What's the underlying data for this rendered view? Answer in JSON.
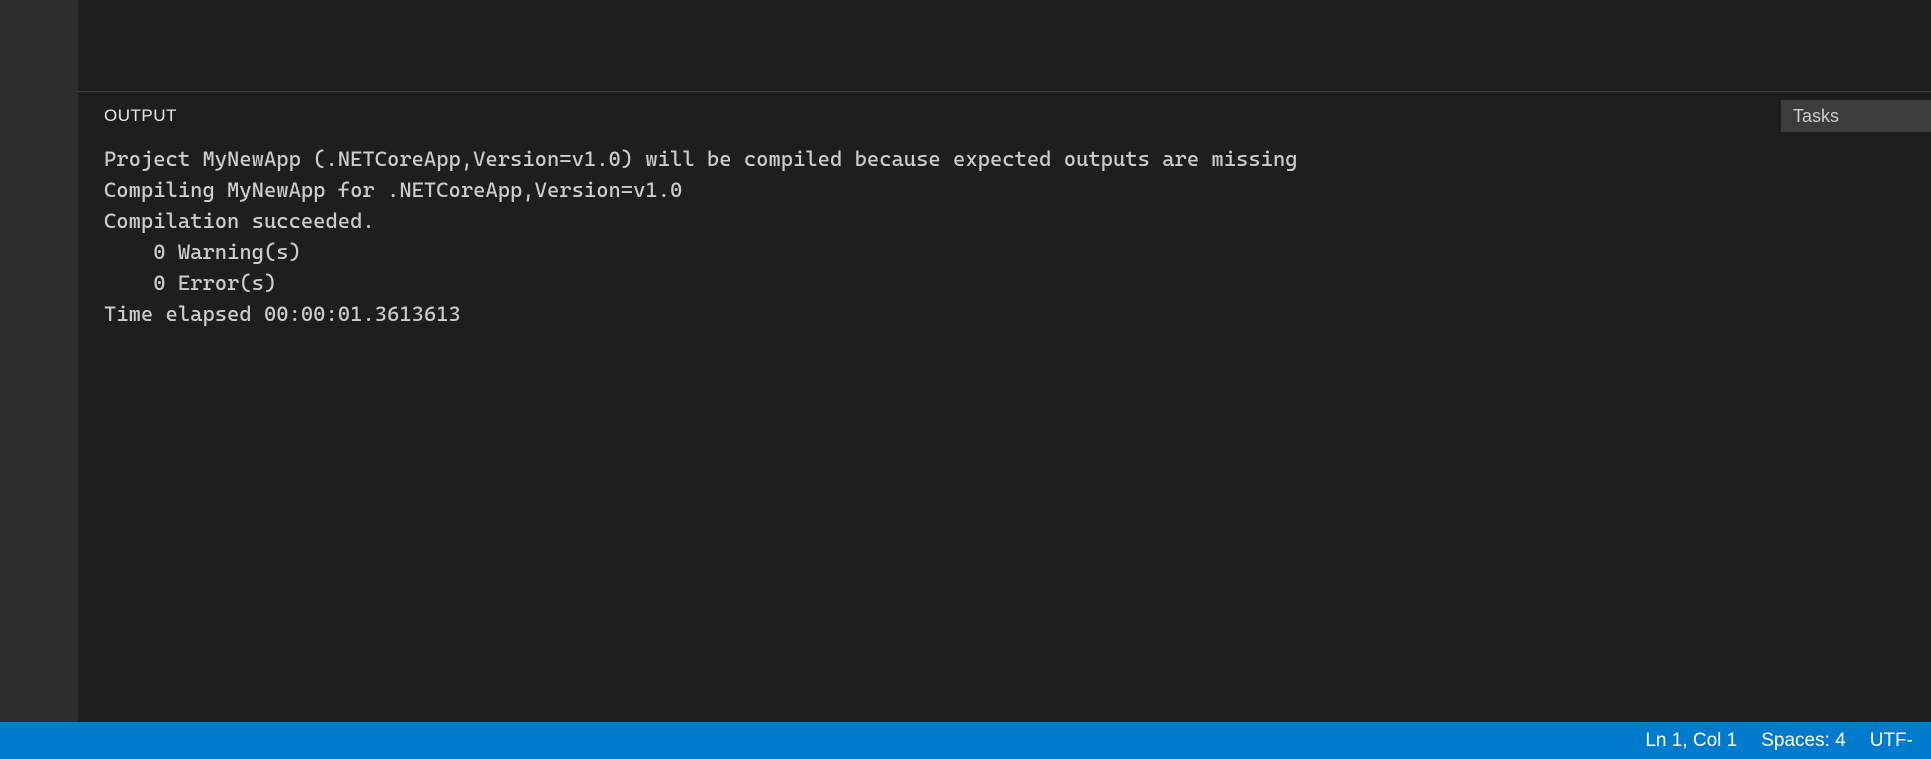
{
  "panel": {
    "tab_label": "OUTPUT",
    "filter_label": "Tasks",
    "output_lines": [
      "Project MyNewApp (.NETCoreApp,Version=v1.0) will be compiled because expected outputs are missing",
      "Compiling MyNewApp for .NETCoreApp,Version=v1.0",
      "Compilation succeeded.",
      "    0 Warning(s)",
      "    0 Error(s)",
      "Time elapsed 00:00:01.3613613"
    ]
  },
  "status_bar": {
    "cursor_position": "Ln 1, Col 1",
    "indentation": "Spaces: 4",
    "encoding": "UTF-"
  }
}
